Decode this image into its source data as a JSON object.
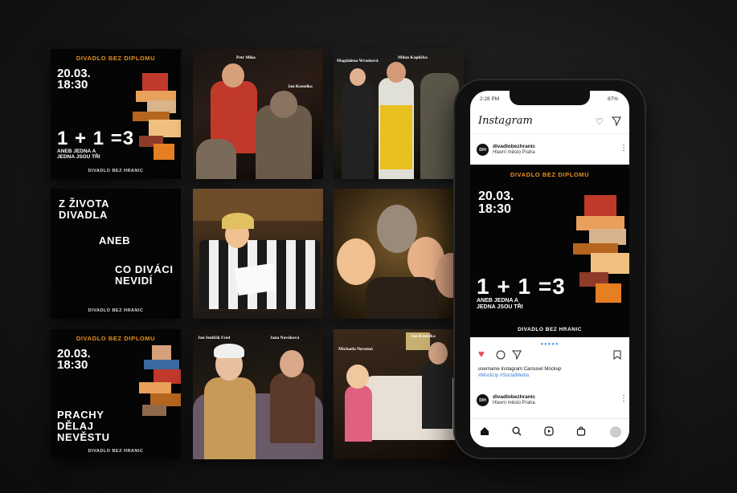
{
  "grid": {
    "poster1": {
      "brand": "DIVADLO BEZ DIPLOMU",
      "date_line1": "20.03.",
      "date_line2": "18:30",
      "headline": "1 + 1 =3",
      "sub_line1": "ANEB JEDNA A",
      "sub_line2": "JEDNA JSOU TŘI",
      "footer": "DIVADLO BEZ HRANIC"
    },
    "photo1": {
      "label_a": "Petr Miko",
      "label_b": "Jan Kostelka"
    },
    "photo2": {
      "label_a": "Magdalena Wrasková",
      "label_b": "Milan Kaplička"
    },
    "poster2": {
      "line1": "Z ŽIVOTA",
      "line2": "DIVADLA",
      "line3": "ANEB",
      "line4": "CO DIVÁCI",
      "line5": "NEVIDÍ",
      "footer": "DIVADLO BEZ HRANIC"
    },
    "poster3": {
      "brand": "DIVADLO BEZ DIPLOMU",
      "date_line1": "20.03.",
      "date_line2": "18:30",
      "line1": "PRACHY",
      "line2": "DĚLAJ",
      "line3": "NEVĚSTU",
      "footer": "DIVADLO BEZ HRANIC"
    },
    "photo5": {
      "label_a": "Jan Smilčík Fred",
      "label_b": "Jana Nováková"
    },
    "photo6": {
      "label_a": "Michaela Novotná",
      "label_b": "Jan Kostelka"
    }
  },
  "phone": {
    "status_time": "2:28 PM",
    "status_battery": "87%",
    "app_title": "Instagram",
    "post": {
      "username": "divadlobezhranic",
      "location": "Hlavní město Praha",
      "brand": "DIVADLO BEZ DIPLOMU",
      "date_line1": "20.03.",
      "date_line2": "18:30",
      "headline": "1 + 1 =3",
      "sub_line1": "ANEB JEDNA A",
      "sub_line2": "JEDNA JSOU TŘI",
      "footer": "DIVADLO BEZ HRANIC",
      "pager": "●●●●●",
      "caption": "username Instagram Carousel Mockup",
      "hashtags": "#MockUp #SocialMedia"
    },
    "next_post": {
      "username": "divadlobezhranic",
      "location": "Hlavní město Praha"
    },
    "avatar_text": "D/H"
  },
  "colors": {
    "accent_orange": "#e8901c",
    "like_red": "#ed4956",
    "background": "#161616"
  },
  "icons": [
    "heart-outline-icon",
    "send-icon",
    "more-icon",
    "heart-filled-icon",
    "comment-icon",
    "bookmark-icon",
    "home-icon",
    "search-icon",
    "reels-icon",
    "shop-icon",
    "profile-icon"
  ]
}
